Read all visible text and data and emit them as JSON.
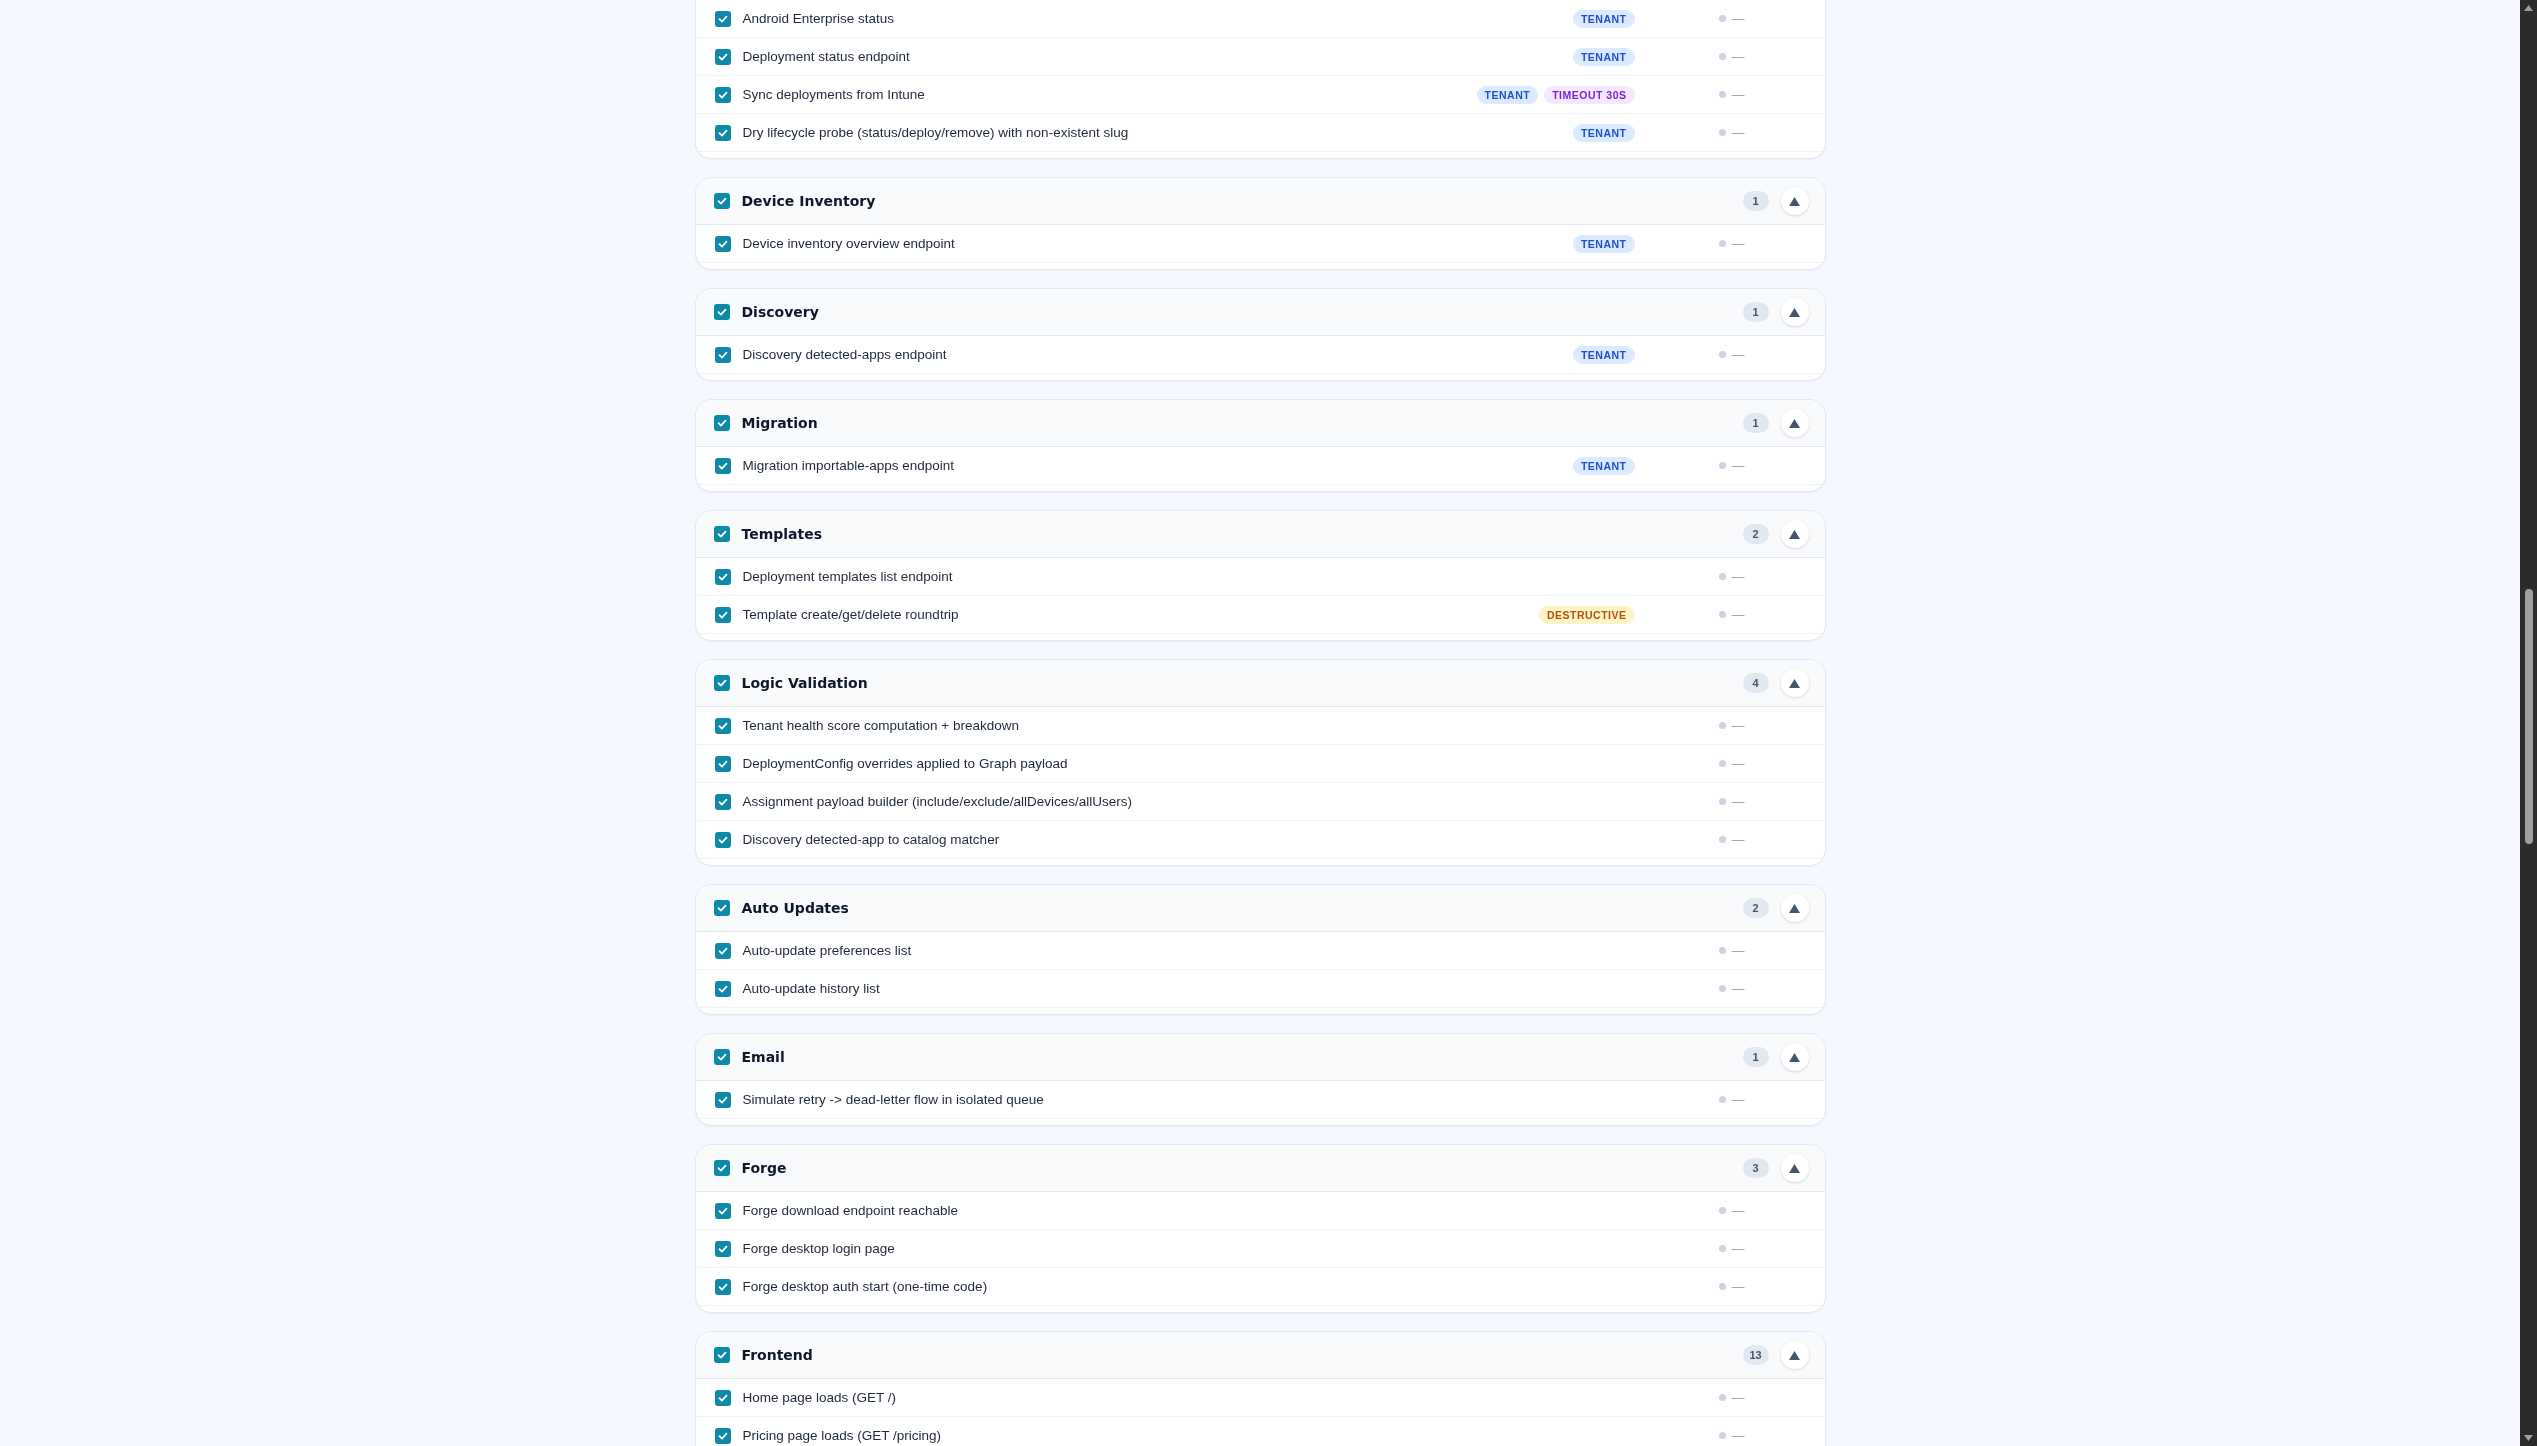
{
  "groups": [
    {
      "tests": [
        {
          "label": "Android Enterprise status",
          "checked": true,
          "badges": [
            {
              "kind": "tenant",
              "text": "TENANT"
            }
          ],
          "result": "—"
        },
        {
          "label": "Deployment status endpoint",
          "checked": true,
          "badges": [
            {
              "kind": "tenant",
              "text": "TENANT"
            }
          ],
          "result": "—"
        },
        {
          "label": "Sync deployments from Intune",
          "checked": true,
          "badges": [
            {
              "kind": "tenant",
              "text": "TENANT"
            },
            {
              "kind": "timeout",
              "text": "TIMEOUT 30S"
            }
          ],
          "result": "—"
        },
        {
          "label": "Dry lifecycle probe (status/deploy/remove) with non-existent slug",
          "checked": true,
          "badges": [
            {
              "kind": "tenant",
              "text": "TENANT"
            }
          ],
          "result": "—"
        }
      ]
    },
    {
      "title": "Device Inventory",
      "checked": true,
      "count": "1",
      "expanded": true,
      "tests": [
        {
          "label": "Device inventory overview endpoint",
          "checked": true,
          "badges": [
            {
              "kind": "tenant",
              "text": "TENANT"
            }
          ],
          "result": "—"
        }
      ]
    },
    {
      "title": "Discovery",
      "checked": true,
      "count": "1",
      "expanded": true,
      "tests": [
        {
          "label": "Discovery detected-apps endpoint",
          "checked": true,
          "badges": [
            {
              "kind": "tenant",
              "text": "TENANT"
            }
          ],
          "result": "—"
        }
      ]
    },
    {
      "title": "Migration",
      "checked": true,
      "count": "1",
      "expanded": true,
      "tests": [
        {
          "label": "Migration importable-apps endpoint",
          "checked": true,
          "badges": [
            {
              "kind": "tenant",
              "text": "TENANT"
            }
          ],
          "result": "—"
        }
      ]
    },
    {
      "title": "Templates",
      "checked": true,
      "count": "2",
      "expanded": true,
      "tests": [
        {
          "label": "Deployment templates list endpoint",
          "checked": true,
          "result": "—"
        },
        {
          "label": "Template create/get/delete roundtrip",
          "checked": true,
          "badges": [
            {
              "kind": "destructive",
              "text": "DESTRUCTIVE"
            }
          ],
          "result": "—"
        }
      ]
    },
    {
      "title": "Logic Validation",
      "checked": true,
      "count": "4",
      "expanded": true,
      "tests": [
        {
          "label": "Tenant health score computation + breakdown",
          "checked": true,
          "result": "—"
        },
        {
          "label": "DeploymentConfig overrides applied to Graph payload",
          "checked": true,
          "result": "—"
        },
        {
          "label": "Assignment payload builder (include/exclude/allDevices/allUsers)",
          "checked": true,
          "result": "—"
        },
        {
          "label": "Discovery detected-app to catalog matcher",
          "checked": true,
          "result": "—"
        }
      ]
    },
    {
      "title": "Auto Updates",
      "checked": true,
      "count": "2",
      "expanded": true,
      "tests": [
        {
          "label": "Auto-update preferences list",
          "checked": true,
          "result": "—"
        },
        {
          "label": "Auto-update history list",
          "checked": true,
          "result": "—"
        }
      ]
    },
    {
      "title": "Email",
      "checked": true,
      "count": "1",
      "expanded": true,
      "tests": [
        {
          "label": "Simulate retry -> dead-letter flow in isolated queue",
          "checked": true,
          "result": "—"
        }
      ]
    },
    {
      "title": "Forge",
      "checked": true,
      "count": "3",
      "expanded": true,
      "tests": [
        {
          "label": "Forge download endpoint reachable",
          "checked": true,
          "result": "—"
        },
        {
          "label": "Forge desktop login page",
          "checked": true,
          "result": "—"
        },
        {
          "label": "Forge desktop auth start (one-time code)",
          "checked": true,
          "result": "—"
        }
      ]
    },
    {
      "title": "Frontend",
      "checked": true,
      "count": "13",
      "expanded": true,
      "tests": [
        {
          "label": "Home page loads (GET /)",
          "checked": true,
          "result": "—"
        },
        {
          "label": "Pricing page loads (GET /pricing)",
          "checked": true,
          "result": "—"
        }
      ]
    }
  ]
}
